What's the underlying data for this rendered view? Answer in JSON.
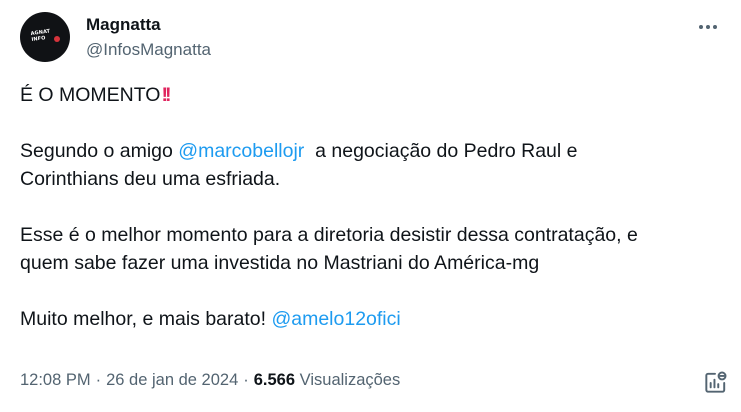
{
  "author": {
    "display_name": "Magnatta",
    "handle": "@InfosMagnatta",
    "avatar_text_line1": "AGNAT",
    "avatar_text_line2": "INFO"
  },
  "tweet": {
    "headline": "É O MOMENTO",
    "headline_emoji": "!!",
    "p1_prefix": "Segundo o amigo ",
    "p1_mention": "@marcobellojr",
    "p1_suffix": "  a negociação do Pedro Raul e",
    "p1_line2": "Corinthians deu uma esfriada.",
    "p2_line1": "Esse é o melhor momento para a diretoria desistir dessa contratação, e",
    "p2_line2": "quem sabe fazer uma investida no Mastriani do América-mg",
    "p3_text": "Muito melhor, e mais barato! ",
    "p3_mention": "@amelo12ofici"
  },
  "meta": {
    "time": "12:08 PM",
    "separator": "·",
    "date": "26 de jan de 2024",
    "views_count": "6.566",
    "views_label": "Visualizações"
  },
  "icons": {
    "more": "more-horizontal-icon",
    "analytics": "post-analytics-icon"
  },
  "colors": {
    "text": "#0f1419",
    "secondary": "#536471",
    "link": "#1d9bf0",
    "emoji": "#e0245e"
  }
}
